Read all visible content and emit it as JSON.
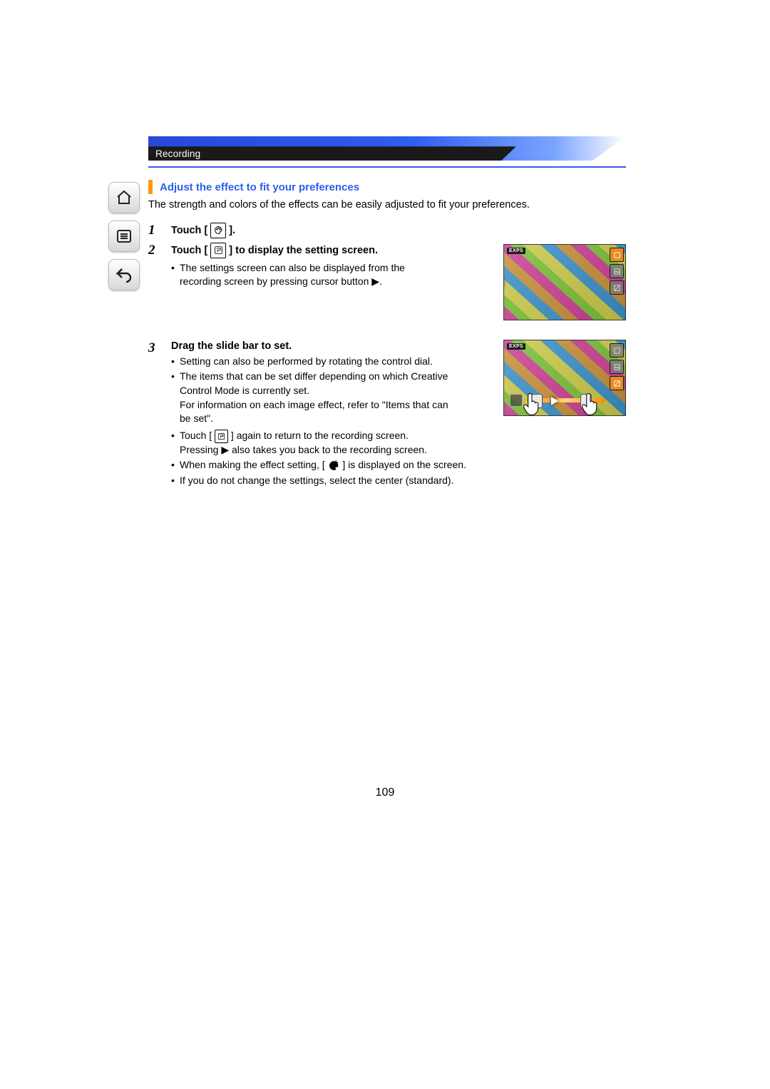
{
  "header": {
    "category": "Recording"
  },
  "section": {
    "title": "Adjust the effect to fit your preferences",
    "intro": "The strength and colors of the effects can be easily adjusted to fit your preferences."
  },
  "steps": {
    "s1": {
      "num": "1",
      "prefix": "Touch [",
      "suffix": "].",
      "icon": "palette-icon"
    },
    "s2": {
      "num": "2",
      "prefix": "Touch [",
      "mid": "] to display the setting screen.",
      "icon": "paint-tool-icon",
      "bullets": {
        "b1a": "The settings screen can also be displayed from the",
        "b1b": "recording screen by pressing cursor button ▶."
      }
    },
    "s3": {
      "num": "3",
      "title": "Drag the slide bar to set.",
      "bullets": {
        "b1": "Setting can also be performed by rotating the control dial.",
        "b2a": "The items that can be set differ depending on which Creative Control Mode is currently set.",
        "b2b": "For information on each image effect, refer to \"Items that can be set\".",
        "b3a": "Touch [",
        "b3b": "] again to return to the recording screen.",
        "b3c": "Pressing ▶ also takes you back to the recording screen.",
        "b4a": "When making the effect setting, [",
        "b4b": "] is displayed on the screen.",
        "b5": "If you do not change the settings, select the center (standard)."
      }
    }
  },
  "thumb": {
    "badge": "EXPS"
  },
  "page_number": "109"
}
